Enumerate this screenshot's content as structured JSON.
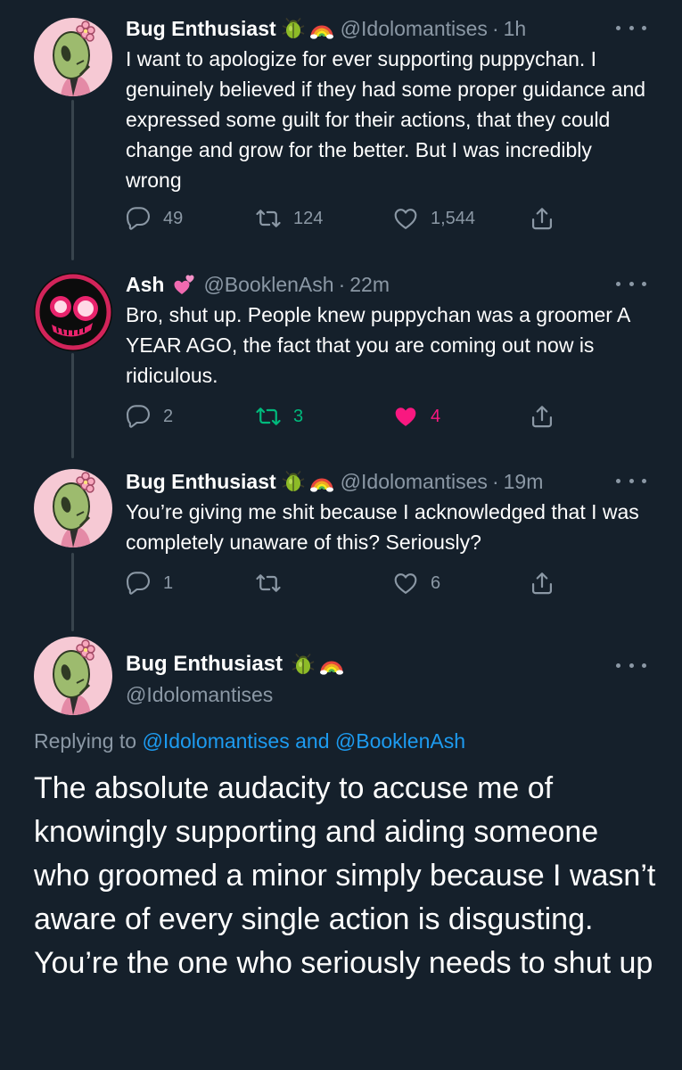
{
  "tweets": [
    {
      "name": "Bug Enthusiast",
      "handle": "@Idolomantises",
      "sep": "·",
      "time": "1h",
      "text": "I want to apologize for ever supporting puppychan. I genuinely believed if they had some proper guidance and expressed some guilt for their actions, that they could change and grow for the better. But I was incredibly wrong",
      "replies": "49",
      "retweets": "124",
      "likes": "1,544",
      "avatar": "mantis-avatar",
      "emojis": [
        "beetle-emoji",
        "rainbow-emoji"
      ]
    },
    {
      "name": "Ash",
      "handle": "@BooklenAsh",
      "sep": "·",
      "time": "22m",
      "text": "Bro, shut up. People knew puppychan was a groomer A YEAR AGO, the fact that you are coming out now is ridiculous.",
      "replies": "2",
      "retweets": "3",
      "likes": "4",
      "avatar": "skull-avatar",
      "emojis": [
        "two-hearts-emoji"
      ],
      "retweeted": true,
      "liked": true
    },
    {
      "name": "Bug Enthusiast",
      "handle": "@Idolomantises",
      "sep": "·",
      "time": "19m",
      "text": "You’re giving me shit because I acknowledged that I was completely unaware of this? Seriously?",
      "replies": "1",
      "retweets": "",
      "likes": "6",
      "avatar": "mantis-avatar",
      "emojis": [
        "beetle-emoji",
        "rainbow-emoji"
      ]
    }
  ],
  "main_tweet": {
    "name": "Bug Enthusiast",
    "handle": "@Idolomantises",
    "replying_prefix": "Replying to",
    "replying_user1": "@Idolomantises",
    "replying_and": "and",
    "replying_user2": "@BooklenAsh",
    "text": "The absolute audacity to accuse me of knowingly supporting and aiding someone who groomed a minor simply because I wasn’t aware of every single action is disgusting. You’re the one who seriously needs to shut up"
  },
  "colors": {
    "background": "#15202b",
    "text": "#ffffff",
    "secondary": "#8b98a5",
    "link": "#1d9bf0",
    "retweet_active": "#00ba7c",
    "like_active": "#f91880"
  }
}
